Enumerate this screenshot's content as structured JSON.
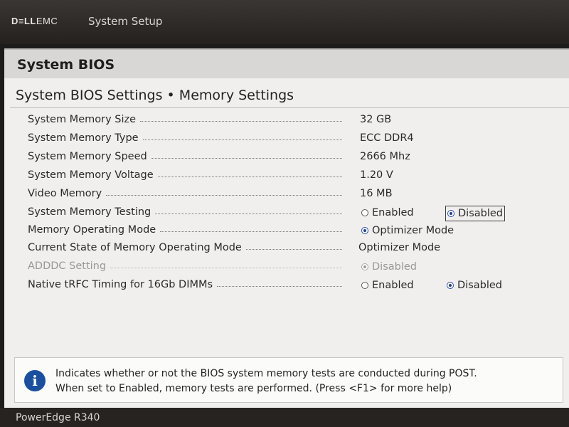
{
  "header": {
    "logo_bold": "D≡LL",
    "logo_rest": "EMC",
    "title": "System Setup"
  },
  "section": {
    "title": "System BIOS"
  },
  "page": {
    "title": "System BIOS Settings • Memory Settings"
  },
  "settings": [
    {
      "label": "System Memory Size",
      "value": "32 GB"
    },
    {
      "label": "System Memory Type",
      "value": "ECC DDR4"
    },
    {
      "label": "System Memory Speed",
      "value": "2666 Mhz"
    },
    {
      "label": "System Memory Voltage",
      "value": "1.20 V"
    },
    {
      "label": "Video Memory",
      "value": "16 MB"
    },
    {
      "label": "System Memory Testing",
      "options": [
        "Enabled",
        "Disabled"
      ],
      "selected": "Disabled"
    },
    {
      "label": "Memory Operating Mode",
      "options": [
        "Optimizer Mode"
      ],
      "selected": "Optimizer Mode"
    },
    {
      "label": "Current State of Memory Operating Mode",
      "value": "Optimizer Mode"
    },
    {
      "label": "ADDDC Setting",
      "options": [
        "Disabled"
      ],
      "selected": "Disabled",
      "disabled": true
    },
    {
      "label": "Native tRFC Timing for 16Gb DIMMs",
      "options": [
        "Enabled",
        "Disabled"
      ],
      "selected": "Disabled"
    }
  ],
  "help": {
    "icon": "info-icon",
    "line1": "Indicates whether or not the BIOS system memory tests are conducted during POST.",
    "line2": "When set to Enabled, memory tests are performed. (Press <F1> for more help)"
  },
  "footer": {
    "model": "PowerEdge R340"
  },
  "colors": {
    "header_bg": "#2b2826",
    "content_bg": "#f1efed",
    "radio_selected": "#1f3f8f",
    "info_icon": "#1a4fa0"
  }
}
